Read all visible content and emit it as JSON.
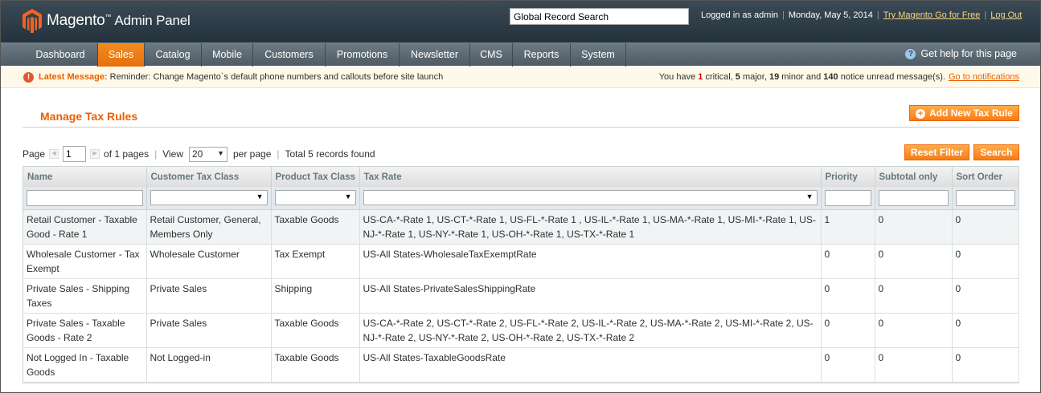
{
  "header": {
    "brand": "Magento",
    "trademark": "™",
    "subtitle": "Admin Panel",
    "global_search_value": "Global Record Search",
    "logged_in": "Logged in as admin",
    "date": "Monday, May 5, 2014",
    "try_link": "Try Magento Go for Free",
    "logout_link": "Log Out",
    "separator": "|"
  },
  "nav": {
    "items": [
      {
        "label": "Dashboard"
      },
      {
        "label": "Sales",
        "active": true
      },
      {
        "label": "Catalog"
      },
      {
        "label": "Mobile"
      },
      {
        "label": "Customers"
      },
      {
        "label": "Promotions"
      },
      {
        "label": "Newsletter"
      },
      {
        "label": "CMS"
      },
      {
        "label": "Reports"
      },
      {
        "label": "System"
      }
    ],
    "help": "Get help for this page"
  },
  "message": {
    "label": "Latest Message:",
    "text": "Reminder: Change Magento`s default phone numbers and callouts before site launch",
    "summary_prefix": "You have",
    "critical_count": "1",
    "critical_label": "critical,",
    "major_count": "5",
    "major_label": "major,",
    "minor_count": "19",
    "minor_label": "minor and",
    "notice_count": "140",
    "notice_label": "notice unread message(s).",
    "link": "Go to notifications"
  },
  "page": {
    "title": "Manage Tax Rules",
    "add_button": "Add New Tax Rule",
    "reset_button": "Reset Filter",
    "search_button": "Search"
  },
  "pager": {
    "page_label": "Page",
    "page_value": "1",
    "of_pages": "of 1 pages",
    "view_label": "View",
    "view_value": "20",
    "per_page": "per page",
    "total": "Total 5 records found"
  },
  "grid": {
    "columns": [
      "Name",
      "Customer Tax Class",
      "Product Tax Class",
      "Tax Rate",
      "Priority",
      "Subtotal only",
      "Sort Order"
    ],
    "rows": [
      [
        "Retail Customer - Taxable Good - Rate 1",
        "Retail Customer, General, Members Only",
        "Taxable Goods",
        "US-CA-*-Rate 1, US-CT-*-Rate 1, US-FL-*-Rate 1 , US-IL-*-Rate 1, US-MA-*-Rate 1, US-MI-*-Rate 1, US-NJ-*-Rate 1, US-NY-*-Rate 1, US-OH-*-Rate 1, US-TX-*-Rate 1",
        "1",
        "0",
        "0"
      ],
      [
        "Wholesale Customer - Tax Exempt",
        "Wholesale Customer",
        "Tax Exempt",
        "US-All States-WholesaleTaxExemptRate",
        "0",
        "0",
        "0"
      ],
      [
        "Private Sales - Shipping Taxes",
        "Private Sales",
        "Shipping",
        "US-All States-PrivateSalesShippingRate",
        "0",
        "0",
        "0"
      ],
      [
        "Private Sales - Taxable Goods - Rate 2",
        "Private Sales",
        "Taxable Goods",
        "US-CA-*-Rate 2, US-CT-*-Rate 2, US-FL-*-Rate 2, US-IL-*-Rate 2, US-MA-*-Rate 2, US-MI-*-Rate 2, US-NJ-*-Rate 2, US-NY-*-Rate 2, US-OH-*-Rate 2, US-TX-*-Rate 2",
        "0",
        "0",
        "0"
      ],
      [
        "Not Logged In - Taxable Goods",
        "Not Logged-in",
        "Taxable Goods",
        "US-All States-TaxableGoodsRate",
        "0",
        "0",
        "0"
      ]
    ]
  },
  "colors": {
    "accent": "#eb5e00",
    "header_bg": "#2a3a46",
    "nav_active": "#f28c1e"
  }
}
